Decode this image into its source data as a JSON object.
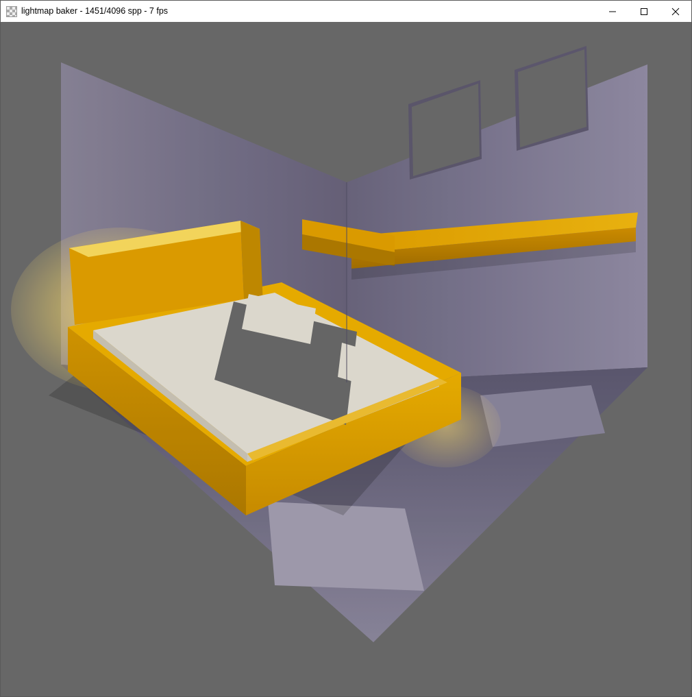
{
  "window": {
    "title_prefix": "lightmap baker",
    "spp_current": 1451,
    "spp_total": 4096,
    "fps": 7,
    "full_title": "lightmap baker - 1451/4096 spp - 7 fps"
  },
  "buttons": {
    "minimize": "Minimize",
    "maximize": "Maximize",
    "close": "Close"
  },
  "scene": {
    "colors": {
      "background": "#6d6d6d",
      "wall_light": "#9a95a8",
      "wall_shadow": "#7a7588",
      "wall_dark": "#6b657a",
      "floor_light": "#b4afc2",
      "floor_tile": "#a5a0b5",
      "floor_shadow": "#67637a",
      "shelf_top": "#e6a300",
      "shelf_front": "#ba8200",
      "bed_frame_top": "#f2b400",
      "bed_frame_side": "#c98f00",
      "bed_frame_front": "#e6a300",
      "headboard_top": "#ffe060",
      "headboard_front": "#e6a300",
      "mattress_light": "#e8e4d8",
      "mattress_dark": "#8f8a7e",
      "window_fill": "#6d6d6d",
      "ao_glow": "#ffdb5c"
    }
  }
}
